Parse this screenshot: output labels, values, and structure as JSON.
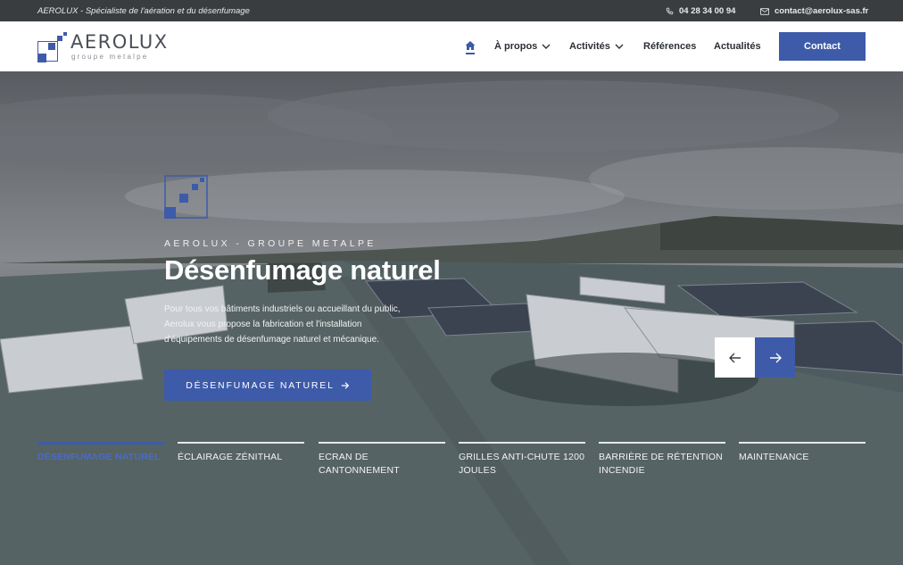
{
  "topbar": {
    "tagline": "AEROLUX - Spécialiste de l'aération et du désenfumage",
    "phone": "04 28 34 00 94",
    "email": "contact@aerolux-sas.fr",
    "icons": {
      "phone": "phone-icon",
      "email": "mail-icon"
    }
  },
  "header": {
    "logo": {
      "name": "AEROLUX",
      "sub": "groupe metalpe"
    },
    "nav": {
      "home_icon": "home-icon",
      "items": [
        {
          "label": "À propos",
          "has_dropdown": true
        },
        {
          "label": "Activités",
          "has_dropdown": true
        },
        {
          "label": "Références",
          "has_dropdown": false
        },
        {
          "label": "Actualités",
          "has_dropdown": false
        }
      ],
      "contact_label": "Contact"
    }
  },
  "hero": {
    "eyebrow": "AEROLUX - GROUPE METALPE",
    "title": "Désenfumage naturel",
    "text": "Pour tous vos bâtiments industriels ou accueillant du public, Aerolux vous propose la fabrication et l'installation d'équipements de désenfumage naturel et mécanique.",
    "cta_label": "DÉSENFUMAGE NATUREL",
    "prev_icon": "arrow-left-icon",
    "next_icon": "arrow-right-icon"
  },
  "tabs": [
    {
      "label": "DÉSENFUMAGE NATUREL",
      "active": true
    },
    {
      "label": "ÉCLAIRAGE ZÉNITHAL",
      "active": false
    },
    {
      "label": "ECRAN DE CANTONNEMENT",
      "active": false
    },
    {
      "label": "GRILLES ANTI-CHUTE 1200 JOULES",
      "active": false
    },
    {
      "label": "BARRIÈRE DE RÉTENTION INCENDIE",
      "active": false
    },
    {
      "label": "MAINTENANCE",
      "active": false
    }
  ],
  "colors": {
    "brand_blue": "#3d5ba9",
    "topbar": "#3a3d40",
    "logo_text": "#4a4f57"
  }
}
